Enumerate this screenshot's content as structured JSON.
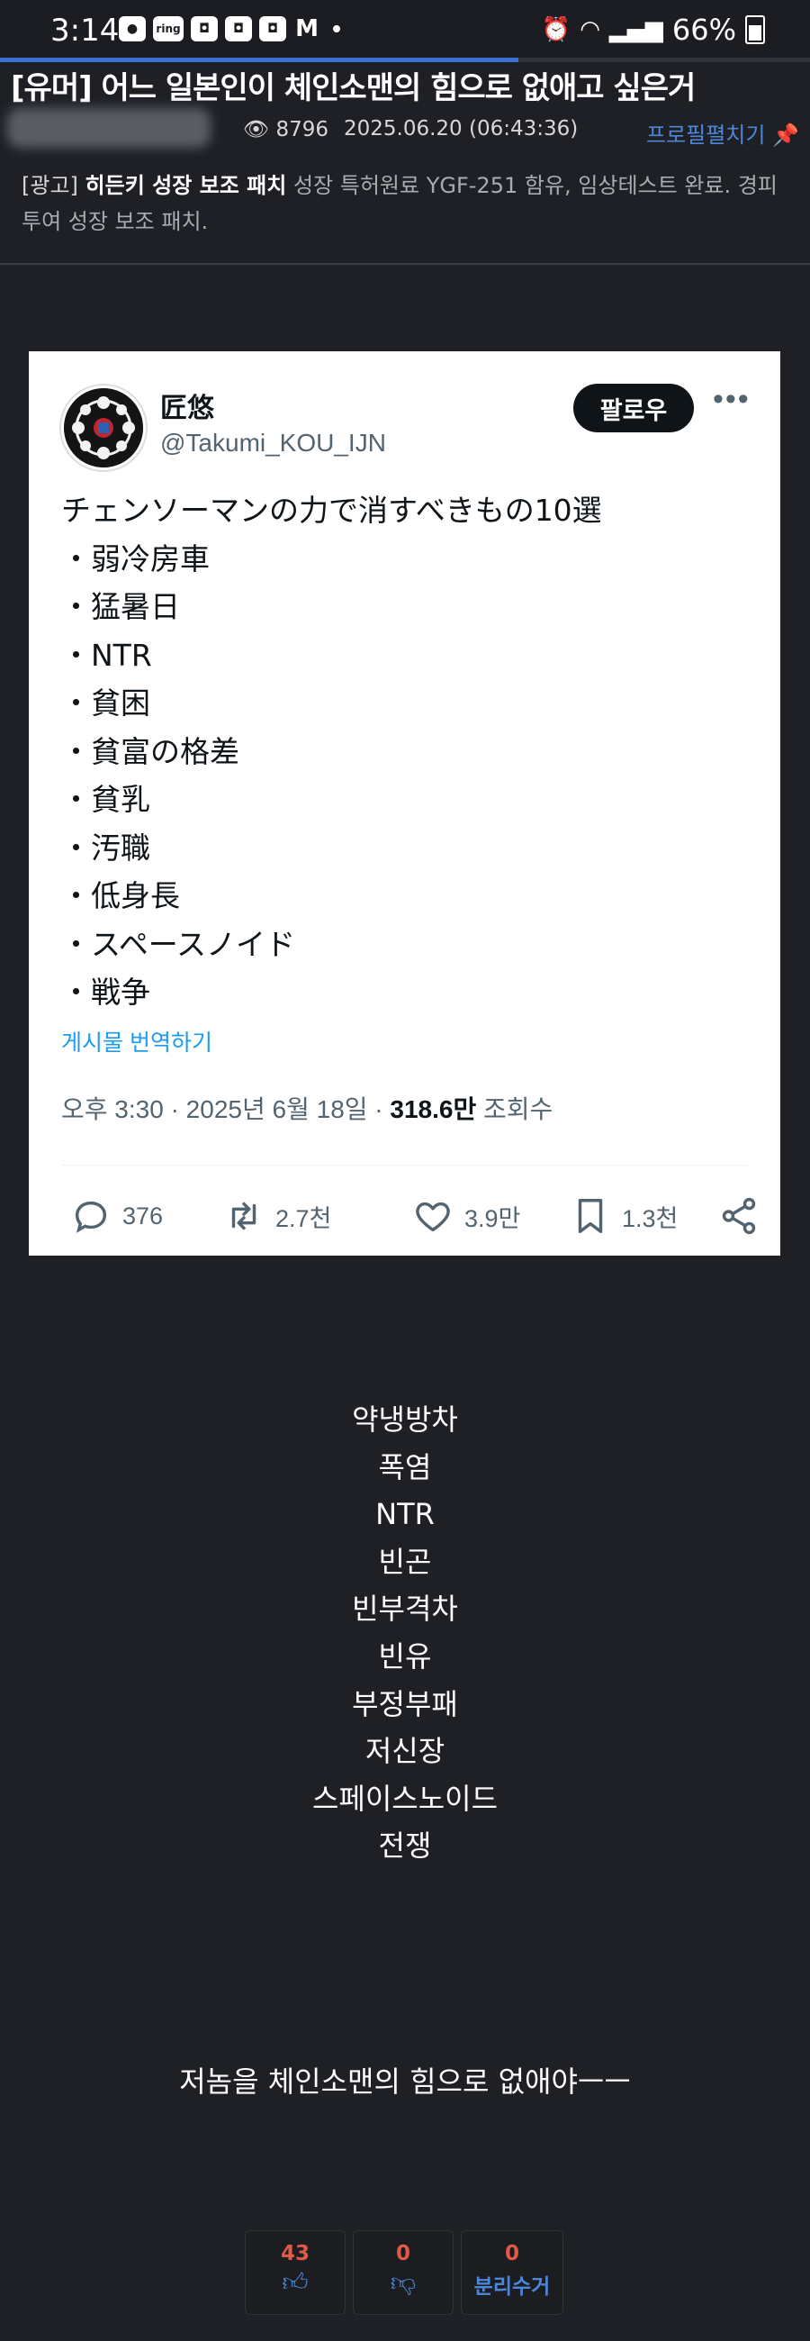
{
  "status_bar": {
    "time": "3:14",
    "battery": "66%",
    "notification_icons": [
      "chat-icon",
      "ring-icon",
      "app-icon",
      "app-icon",
      "app-icon",
      "gmail-icon"
    ],
    "ring_label": "ring",
    "progress": 0.64
  },
  "post": {
    "title": "[유머] 어느 일본인이 체인소맨의 힘으로 없애고 싶은거",
    "views": "8796",
    "date": "2025.06.20 (06:43:36)",
    "profile_link": "프로필펼치기"
  },
  "ad": {
    "tag": "[광고]",
    "product": "히든키 성장 보조 패치",
    "text": "성장 특허원료 YGF-251 함유, 임상테스트 완료. 경피투여 성장 보조 패치."
  },
  "tweet": {
    "name": "匠悠",
    "handle": "@Takumi_KOU_IJN",
    "follow_label": "팔로우",
    "lines": [
      "チェンソーマンの力で消すべきもの10選",
      "・弱冷房車",
      "・猛暑日",
      "・NTR",
      "・貧困",
      "・貧富の格差",
      "・貧乳",
      "・汚職",
      "・低身長",
      "・スペースノイド",
      "・戦争"
    ],
    "translate": "게시물 번역하기",
    "time_prefix": "오후 3:30 · 2025년 6월 18일 · ",
    "views_count": "318.6만",
    "views_label": " 조회수",
    "replies": "376",
    "reposts": "2.7천",
    "likes": "3.9만",
    "bookmarks": "1.3천"
  },
  "translation": [
    "약냉방차",
    "폭염",
    "NTR",
    "빈곤",
    "빈부격차",
    "빈유",
    "부정부패",
    "저신장",
    "스페이스노이드",
    "전쟁"
  ],
  "footer_text": "저놈을 체인소맨의 힘으로 없애야ㅡㅡ",
  "votes": {
    "up": "43",
    "down": "0",
    "report_count": "0",
    "report_label": "분리수거"
  },
  "colors": {
    "background": "#1e2026",
    "link_blue": "#4d86d8",
    "vote_red": "#e05a47",
    "tweet_link": "#1d9bf0"
  }
}
